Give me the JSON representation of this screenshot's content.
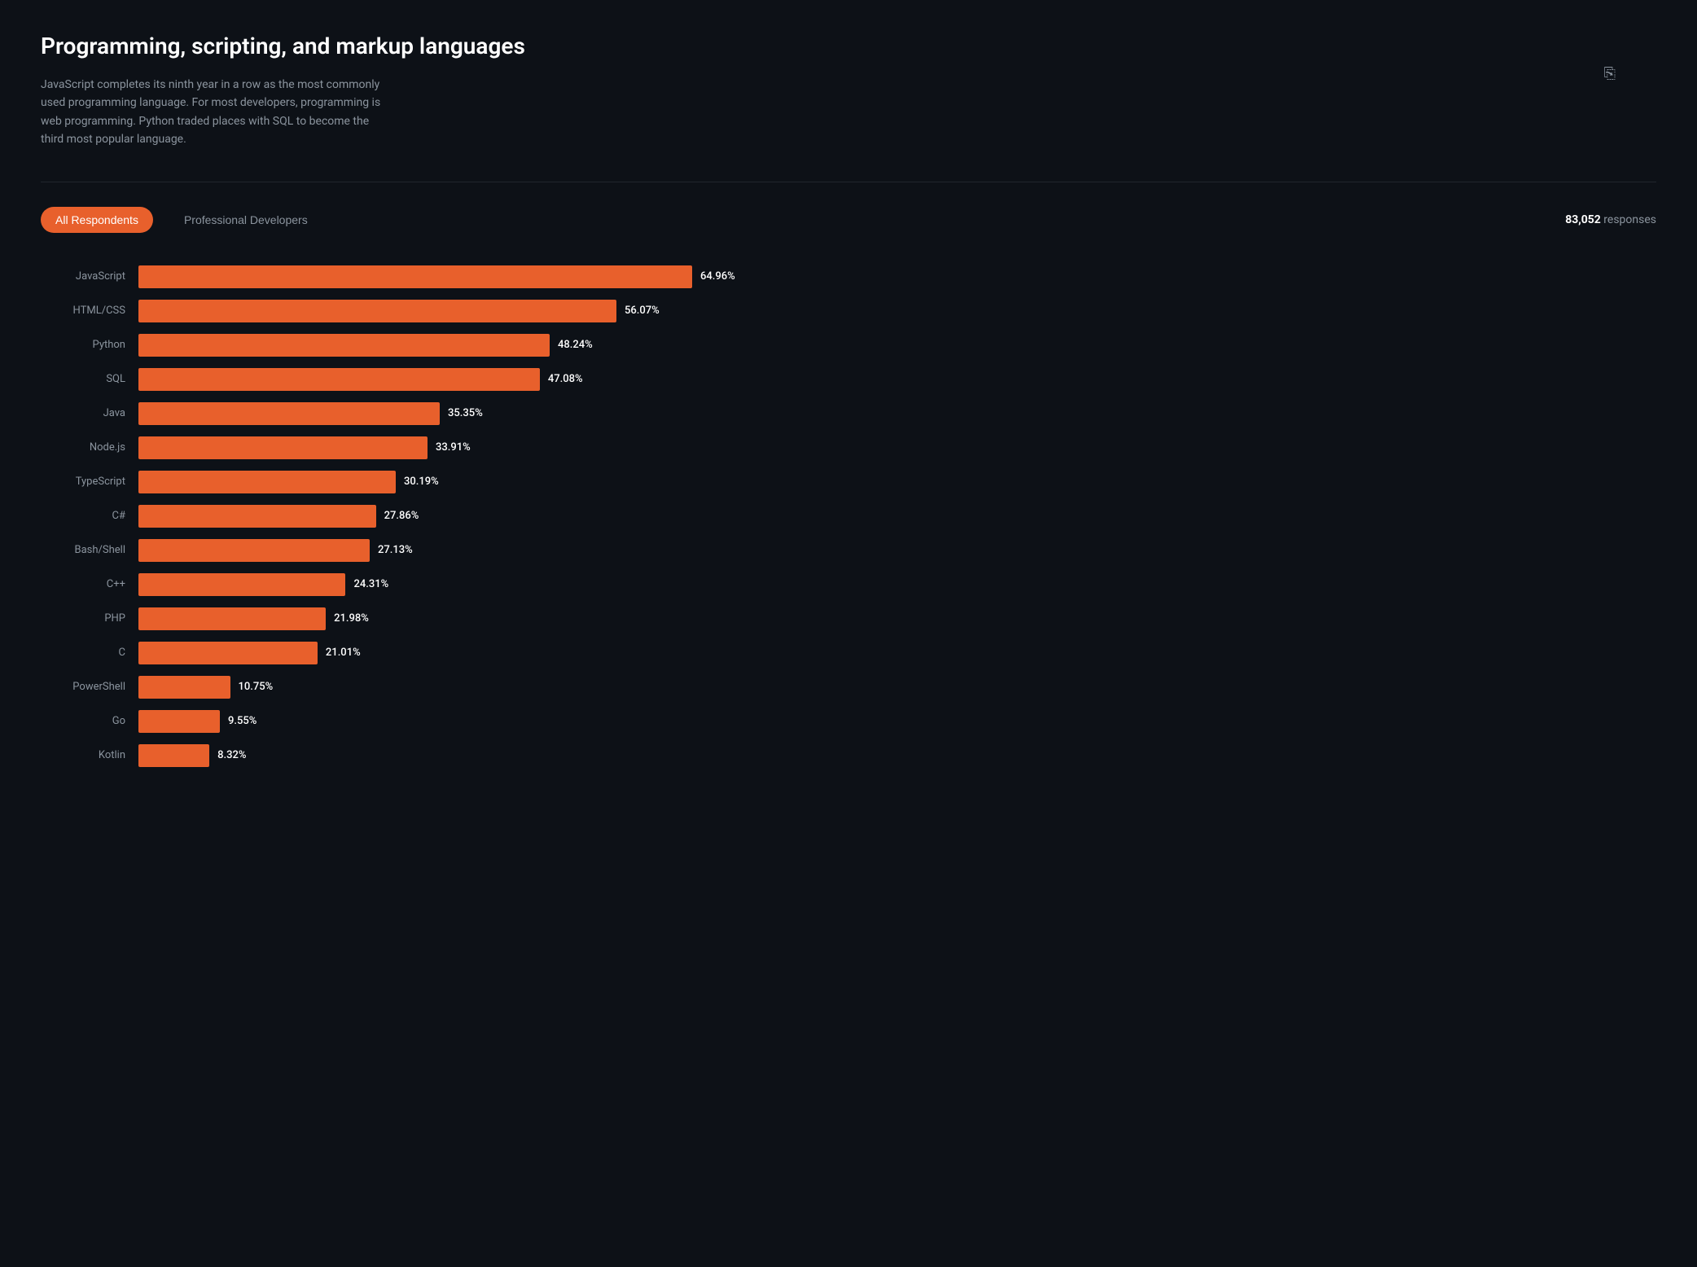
{
  "page": {
    "title": "Programming, scripting, and markup languages",
    "description": "JavaScript completes its ninth year in a row as the most commonly used programming language. For most developers, programming is web programming. Python traded places with SQL to become the third most popular language.",
    "responses": {
      "count": "83,052",
      "label": "responses"
    },
    "tabs": [
      {
        "id": "all",
        "label": "All Respondents",
        "active": true
      },
      {
        "id": "pro",
        "label": "Professional Developers",
        "active": false
      }
    ]
  },
  "chart": {
    "max_pct": 64.96,
    "bars": [
      {
        "label": "JavaScript",
        "pct": 64.96,
        "pct_str": "64.96%"
      },
      {
        "label": "HTML/CSS",
        "pct": 56.07,
        "pct_str": "56.07%"
      },
      {
        "label": "Python",
        "pct": 48.24,
        "pct_str": "48.24%"
      },
      {
        "label": "SQL",
        "pct": 47.08,
        "pct_str": "47.08%"
      },
      {
        "label": "Java",
        "pct": 35.35,
        "pct_str": "35.35%"
      },
      {
        "label": "Node.js",
        "pct": 33.91,
        "pct_str": "33.91%"
      },
      {
        "label": "TypeScript",
        "pct": 30.19,
        "pct_str": "30.19%"
      },
      {
        "label": "C#",
        "pct": 27.86,
        "pct_str": "27.86%"
      },
      {
        "label": "Bash/Shell",
        "pct": 27.13,
        "pct_str": "27.13%"
      },
      {
        "label": "C++",
        "pct": 24.31,
        "pct_str": "24.31%"
      },
      {
        "label": "PHP",
        "pct": 21.98,
        "pct_str": "21.98%"
      },
      {
        "label": "C",
        "pct": 21.01,
        "pct_str": "21.01%"
      },
      {
        "label": "PowerShell",
        "pct": 10.75,
        "pct_str": "10.75%"
      },
      {
        "label": "Go",
        "pct": 9.55,
        "pct_str": "9.55%"
      },
      {
        "label": "Kotlin",
        "pct": 8.32,
        "pct_str": "8.32%"
      }
    ]
  }
}
